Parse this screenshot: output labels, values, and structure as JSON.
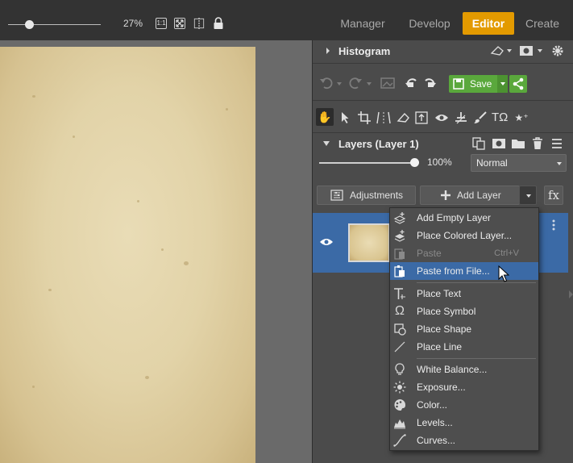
{
  "toolbar": {
    "zoom_percent": "27%",
    "zoom_level": 0.27,
    "icons": [
      "actual-size-icon",
      "fit-to-screen-icon",
      "compare-icon",
      "lock-icon"
    ],
    "actual_size_label": "1:1"
  },
  "modes": [
    {
      "label": "Manager",
      "active": false
    },
    {
      "label": "Develop",
      "active": false
    },
    {
      "label": "Editor",
      "active": true
    },
    {
      "label": "Create",
      "active": false
    }
  ],
  "colors": {
    "accent_orange": "#e39a00",
    "save_green": "#5aa83c",
    "selection_blue": "#3b6aa6",
    "panel_bg": "#4b4b4b"
  },
  "histogram": {
    "title": "Histogram"
  },
  "actions": {
    "save_label": "Save"
  },
  "layers": {
    "title": "Layers (Layer 1)",
    "opacity": "100%",
    "opacity_value": 1.0,
    "blend_mode": "Normal",
    "adjustments_label": "Adjustments",
    "add_layer_label": "Add Layer",
    "fx_label": "fx"
  },
  "menu": {
    "items": [
      {
        "label": "Add Empty Layer",
        "icon": "layers-add-icon",
        "shortcut": "",
        "disabled": false
      },
      {
        "label": "Place Colored Layer...",
        "icon": "layers-color-icon",
        "shortcut": "",
        "disabled": false
      },
      {
        "label": "Paste",
        "icon": "paste-icon",
        "shortcut": "Ctrl+V",
        "disabled": true
      },
      {
        "label": "Paste from File...",
        "icon": "paste-file-icon",
        "shortcut": "",
        "disabled": false
      },
      {
        "label": "Place Text",
        "icon": "text-icon",
        "shortcut": "",
        "disabled": false
      },
      {
        "label": "Place Symbol",
        "icon": "omega-icon",
        "shortcut": "",
        "disabled": false
      },
      {
        "label": "Place Shape",
        "icon": "shape-icon",
        "shortcut": "",
        "disabled": false
      },
      {
        "label": "Place Line",
        "icon": "line-icon",
        "shortcut": "",
        "disabled": false
      },
      {
        "label": "White Balance...",
        "icon": "bulb-icon",
        "shortcut": "",
        "disabled": false
      },
      {
        "label": "Exposure...",
        "icon": "sun-icon",
        "shortcut": "",
        "disabled": false
      },
      {
        "label": "Color...",
        "icon": "palette-icon",
        "shortcut": "",
        "disabled": false
      },
      {
        "label": "Levels...",
        "icon": "levels-icon",
        "shortcut": "",
        "disabled": false
      },
      {
        "label": "Curves...",
        "icon": "curves-icon",
        "shortcut": "",
        "disabled": false
      }
    ]
  }
}
